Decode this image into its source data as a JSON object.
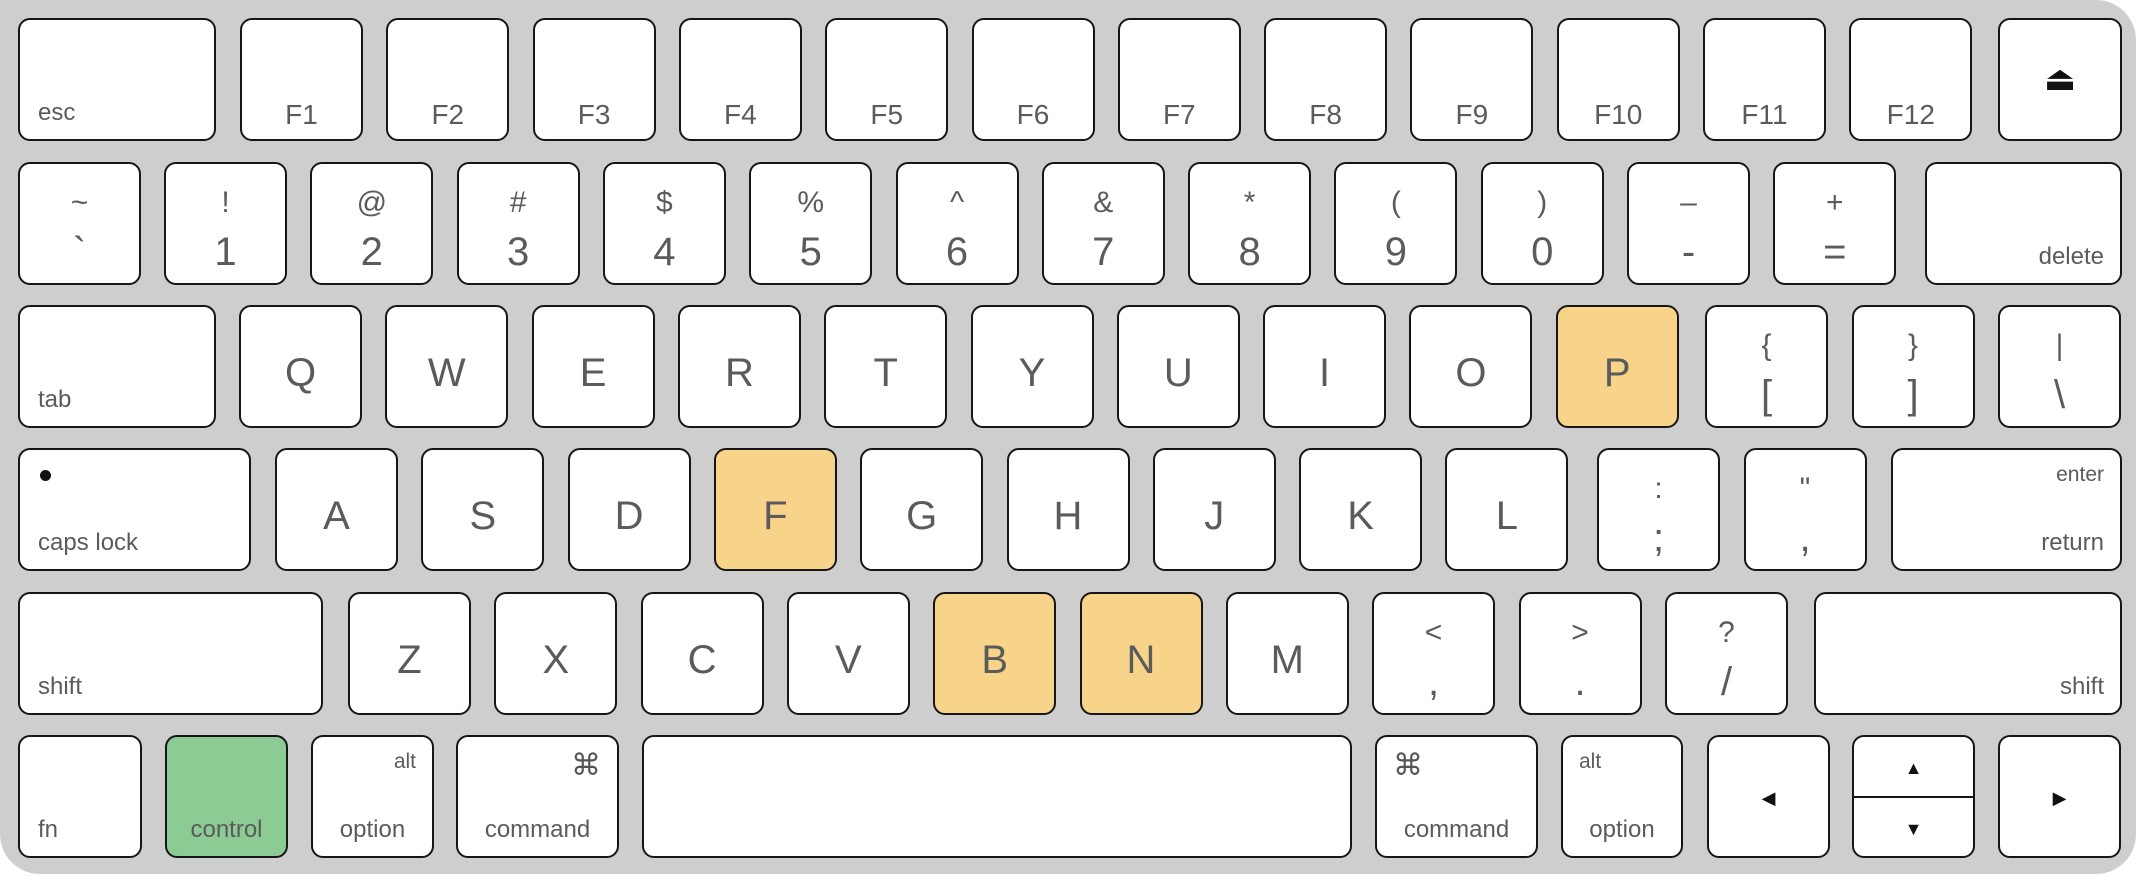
{
  "keyboard": {
    "colors": {
      "board": "#cecece",
      "key": "#ffffff",
      "highlight_yellow": "#f8d48a",
      "highlight_green": "#8ccb94",
      "label": "#5b5b5b"
    },
    "highlighted_keys": {
      "yellow": [
        "P",
        "F",
        "B",
        "N"
      ],
      "green": [
        "control"
      ]
    },
    "rows": {
      "function": {
        "esc": "esc",
        "f": [
          "F1",
          "F2",
          "F3",
          "F4",
          "F5",
          "F6",
          "F7",
          "F8",
          "F9",
          "F10",
          "F11",
          "F12"
        ],
        "eject_icon": "eject-icon",
        "eject_glyph": "⏏"
      },
      "number": {
        "keys": [
          {
            "top": "~",
            "bottom": "`"
          },
          {
            "top": "!",
            "bottom": "1"
          },
          {
            "top": "@",
            "bottom": "2"
          },
          {
            "top": "#",
            "bottom": "3"
          },
          {
            "top": "$",
            "bottom": "4"
          },
          {
            "top": "%",
            "bottom": "5"
          },
          {
            "top": "^",
            "bottom": "6"
          },
          {
            "top": "&",
            "bottom": "7"
          },
          {
            "top": "*",
            "bottom": "8"
          },
          {
            "top": "(",
            "bottom": "9"
          },
          {
            "top": ")",
            "bottom": "0"
          },
          {
            "top": "–",
            "bottom": "-"
          },
          {
            "top": "+",
            "bottom": "="
          }
        ],
        "delete": "delete"
      },
      "qwerty": {
        "tab": "tab",
        "letters": [
          "Q",
          "W",
          "E",
          "R",
          "T",
          "Y",
          "U",
          "I",
          "O",
          "P"
        ],
        "symbols": [
          {
            "top": "{",
            "bottom": "["
          },
          {
            "top": "}",
            "bottom": "]"
          },
          {
            "top": "|",
            "bottom": "\\"
          }
        ]
      },
      "home": {
        "caps_lock": "caps lock",
        "letters": [
          "A",
          "S",
          "D",
          "F",
          "G",
          "H",
          "J",
          "K",
          "L"
        ],
        "symbols": [
          {
            "top": ":",
            "bottom": ";"
          },
          {
            "top": "\"",
            "bottom": ","
          }
        ],
        "enter_top": "enter",
        "enter_bottom": "return"
      },
      "bottom_letters": {
        "shift_left": "shift",
        "letters": [
          "Z",
          "X",
          "C",
          "V",
          "B",
          "N",
          "M"
        ],
        "symbols": [
          {
            "top": "<",
            "bottom": ","
          },
          {
            "top": ">",
            "bottom": "."
          },
          {
            "top": "?",
            "bottom": "/"
          }
        ],
        "shift_right": "shift"
      },
      "modifiers": {
        "fn": "fn",
        "control": "control",
        "option_left_top": "alt",
        "option_left": "option",
        "command_left_glyph": "⌘",
        "command_left": "command",
        "command_right_glyph": "⌘",
        "command_right": "command",
        "option_right_top": "alt",
        "option_right": "option",
        "arrow_left": "◀",
        "arrow_up": "▲",
        "arrow_down": "▼",
        "arrow_right": "▶"
      }
    }
  }
}
